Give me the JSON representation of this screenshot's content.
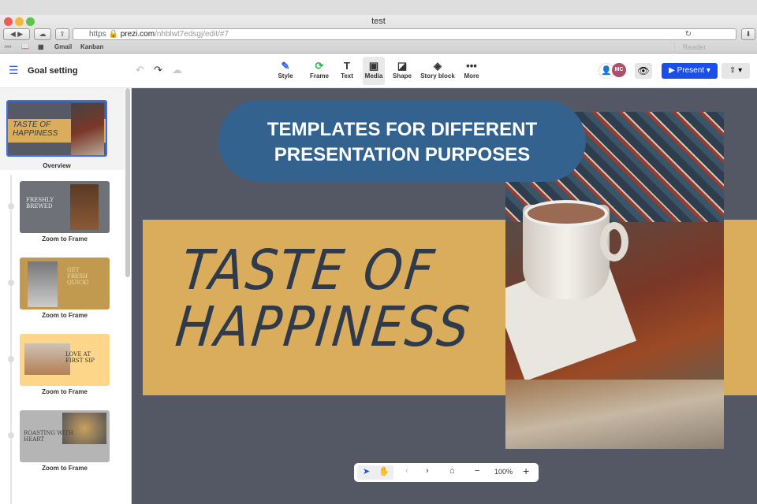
{
  "browser": {
    "title": "test",
    "url_scheme": "https",
    "url_host": "prezi.com",
    "url_path": "/nhblwt7edsgj/edit/#7",
    "reader": "Reader",
    "bookmarks": [
      "Gmail",
      "Kanban"
    ]
  },
  "header": {
    "doc_title": "Goal setting",
    "tools": [
      {
        "label": "Style",
        "icon": "pen-icon"
      },
      {
        "label": "Frame",
        "icon": "frame-icon"
      },
      {
        "label": "Text",
        "icon": "text-icon"
      },
      {
        "label": "Media",
        "icon": "media-icon"
      },
      {
        "label": "Shape",
        "icon": "shape-icon"
      },
      {
        "label": "Story block",
        "icon": "layers-icon"
      },
      {
        "label": "More",
        "icon": "more-icon"
      }
    ],
    "avatar": "MC",
    "present": "Present"
  },
  "sidebar": {
    "overview_label": "Overview",
    "overview_title": "TASTE OF HAPPINESS",
    "frames": [
      {
        "title": "FRESHLY BREWED",
        "label": "Zoom to Frame"
      },
      {
        "title": "GET FRESH QUICK!",
        "label": "Zoom to Frame"
      },
      {
        "title": "LOVE AT FIRST SIP",
        "label": "Zoom to Frame"
      },
      {
        "title": "ROASTING WITH HEART",
        "label": "Zoom to Frame"
      }
    ]
  },
  "canvas": {
    "banner_line1": "TEMPLATES FOR DIFFERENT",
    "banner_line2": "PRESENTATION PURPOSES",
    "slide_line1": "TASTE OF",
    "slide_line2": "HAPPINESS"
  },
  "zoombar": {
    "zoom": "100%"
  },
  "colors": {
    "accent": "#1b4fe8",
    "slide_band": "#d9ad5b",
    "canvas_bg": "#545864",
    "banner": "#34628f"
  }
}
